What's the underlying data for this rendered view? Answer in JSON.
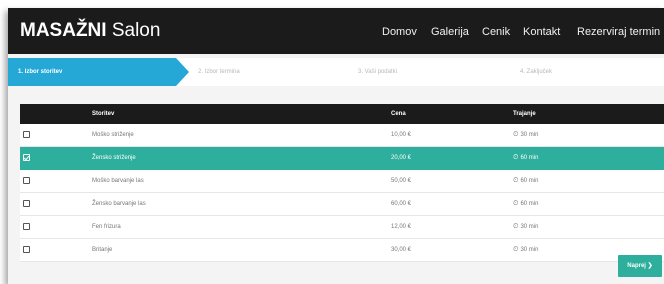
{
  "header": {
    "brand_bold": "MASAŽNI",
    "brand_light": "Salon",
    "nav": [
      "Domov",
      "Galerija",
      "Cenik",
      "Kontakt",
      "Rezerviraj termin"
    ],
    "nav_arrow": "❯"
  },
  "steps": [
    {
      "label": "1. Izbor storitev",
      "active": true
    },
    {
      "label": "2. Izbor termina",
      "active": false
    },
    {
      "label": "3. Vaši podatki",
      "active": false
    },
    {
      "label": "4. Zaključek",
      "active": false
    }
  ],
  "table": {
    "columns": [
      "Storitev",
      "Cena",
      "Trajanje"
    ],
    "rows": [
      {
        "service": "Moško striženje",
        "price": "10,00 €",
        "duration": "30 min",
        "checked": false
      },
      {
        "service": "Žensko striženje",
        "price": "20,00 €",
        "duration": "60 min",
        "checked": true
      },
      {
        "service": "Moško barvanje las",
        "price": "50,00 €",
        "duration": "60 min",
        "checked": false
      },
      {
        "service": "Žensko barvanje las",
        "price": "60,00 €",
        "duration": "60 min",
        "checked": false
      },
      {
        "service": "Fen frizura",
        "price": "12,00 €",
        "duration": "30 min",
        "checked": false
      },
      {
        "service": "Britanje",
        "price": "30,00 €",
        "duration": "30 min",
        "checked": false
      }
    ]
  },
  "next_button": {
    "label": "Naprej",
    "arrow": "❯"
  },
  "colors": {
    "header_bg": "#1b1b1b",
    "step_active": "#25a8d6",
    "selected_row": "#2eae9c",
    "button": "#2eae9c"
  }
}
